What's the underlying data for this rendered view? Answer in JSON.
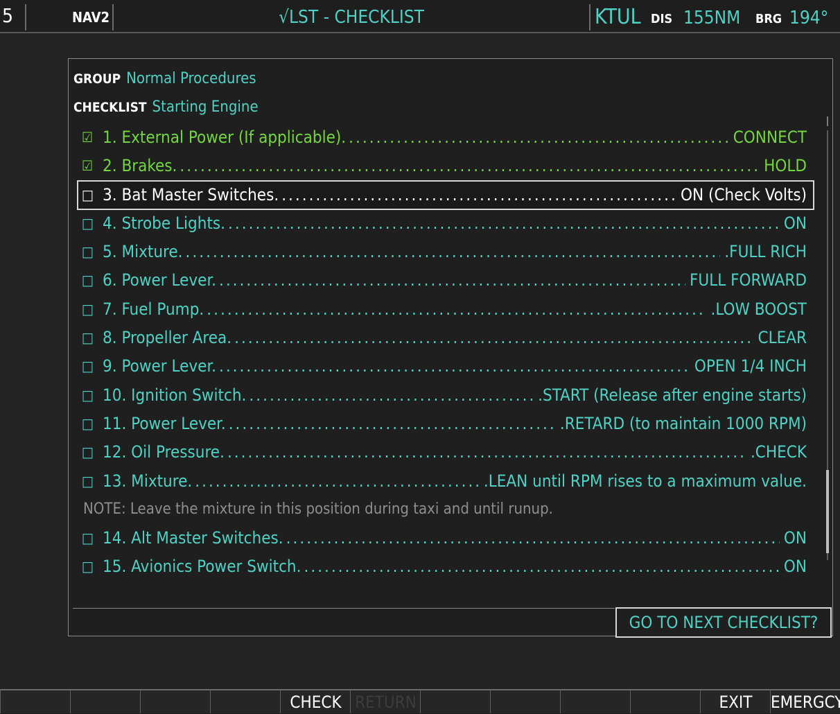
{
  "topbar": {
    "left_number": "5",
    "nav_label": "NAV2",
    "page_title": "√LST - CHECKLIST",
    "waypoint": "KTUL",
    "dis_label": "DIS",
    "dis_value": "155NM",
    "brg_label": "BRG",
    "brg_value": "194°"
  },
  "checklist": {
    "group_label": "GROUP",
    "group_value": "Normal Procedures",
    "checklist_label": "CHECKLIST",
    "checklist_value": "Starting Engine",
    "checked_box": "☑",
    "unchecked_box": "□",
    "items": [
      {
        "text": "1. External Power (If applicable).",
        "action": "CONNECT",
        "checked": true
      },
      {
        "text": "2. Brakes.",
        "action": "HOLD",
        "checked": true
      },
      {
        "text": "3. Bat Master Switches.",
        "action": "ON (Check Volts)",
        "checked": false,
        "selected": true
      },
      {
        "text": "4. Strobe Lights.",
        "action": "ON",
        "checked": false
      },
      {
        "text": "5. Mixture.",
        "action": ".FULL RICH",
        "checked": false
      },
      {
        "text": "6. Power Lever.",
        "action": "FULL FORWARD",
        "checked": false
      },
      {
        "text": "7. Fuel Pump.",
        "action": ".LOW BOOST",
        "checked": false
      },
      {
        "text": "8. Propeller Area.",
        "action": "CLEAR",
        "checked": false
      },
      {
        "text": "9. Power Lever.",
        "action": "OPEN 1/4 INCH",
        "checked": false
      },
      {
        "text": "10. Ignition Switch.",
        "action": ".START (Release after engine starts)",
        "checked": false
      },
      {
        "text": "11. Power Lever.",
        "action": ".RETARD (to maintain 1000 RPM)",
        "checked": false
      },
      {
        "text": "12. Oil Pressure.",
        "action": ".CHECK",
        "checked": false
      },
      {
        "text": "13. Mixture.",
        "action": ".LEAN until RPM rises to a maximum value.",
        "checked": false
      }
    ],
    "note": "NOTE:  Leave the mixture in this position during taxi and until runup.",
    "items_after_note": [
      {
        "text": "14. Alt Master Switches.",
        "action": "ON",
        "checked": false
      },
      {
        "text": "15. Avionics Power Switch.",
        "action": "ON",
        "checked": false
      }
    ],
    "next_button": "GO TO NEXT CHECKLIST?"
  },
  "softkeys": [
    {
      "label": "",
      "enabled": true
    },
    {
      "label": "",
      "enabled": true
    },
    {
      "label": "",
      "enabled": true
    },
    {
      "label": "",
      "enabled": true
    },
    {
      "label": "CHECK",
      "enabled": true
    },
    {
      "label": "RETURN",
      "enabled": false
    },
    {
      "label": "",
      "enabled": true
    },
    {
      "label": "",
      "enabled": true
    },
    {
      "label": "",
      "enabled": true
    },
    {
      "label": "",
      "enabled": true
    },
    {
      "label": "EXIT",
      "enabled": true
    },
    {
      "label": "EMERGCY",
      "enabled": true
    }
  ],
  "colors": {
    "cyan": "#4fd2c3",
    "green": "#73d640",
    "white": "#ffffff",
    "gray": "#8e8e8e"
  }
}
